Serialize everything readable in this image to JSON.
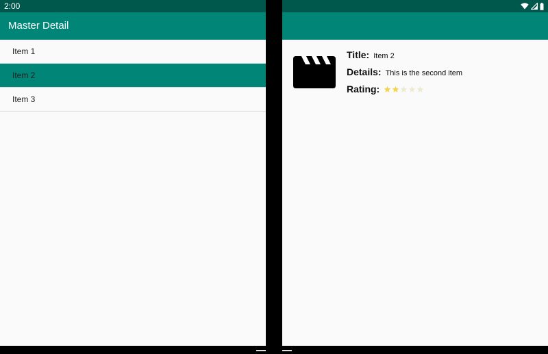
{
  "status_bar": {
    "time": "2:00",
    "background": "#00574b",
    "icons": [
      "wifi-icon",
      "cell-signal-icon",
      "battery-icon"
    ]
  },
  "master": {
    "app_title": "Master Detail",
    "app_bar_color": "#008577",
    "items": [
      {
        "label": "Item 1",
        "selected": false
      },
      {
        "label": "Item 2",
        "selected": true
      },
      {
        "label": "Item 3",
        "selected": false
      }
    ]
  },
  "detail": {
    "icon": "movie-clapperboard-icon",
    "title_label": "Title:",
    "title_value": "Item 2",
    "details_label": "Details:",
    "details_value": "This is the second item",
    "rating_label": "Rating:",
    "rating_value": 2,
    "rating_max": 5,
    "star_color_filled": "#f5d44a",
    "star_color_empty": "#ecebd0"
  }
}
